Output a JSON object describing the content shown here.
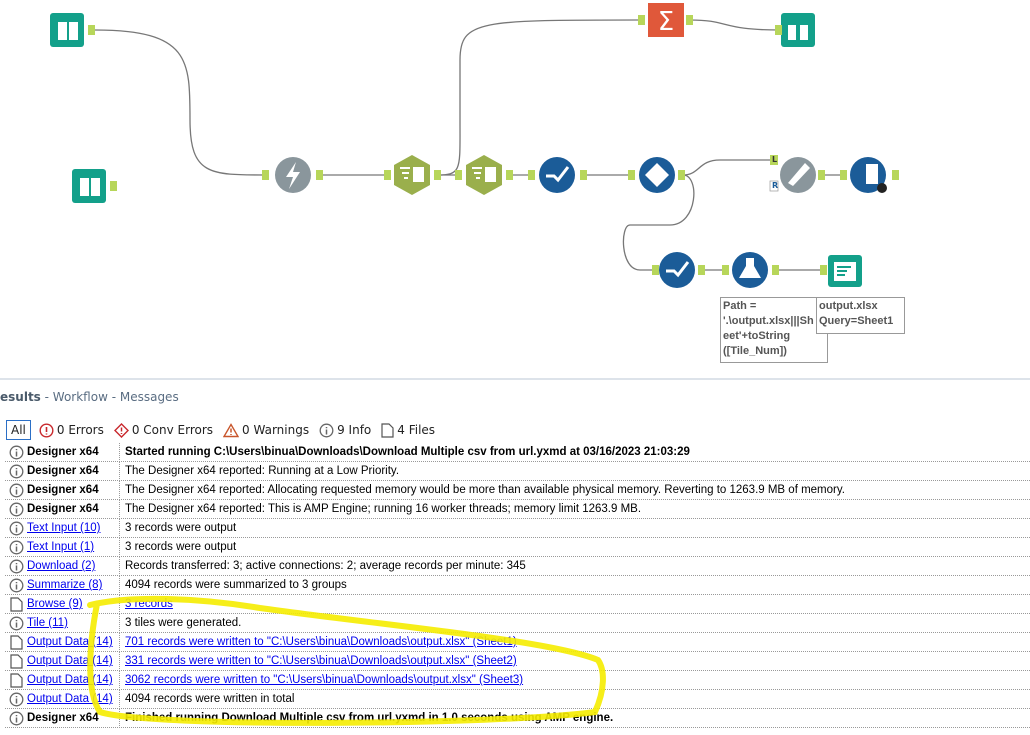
{
  "annotations": {
    "formula": [
      "Path =",
      "'.\\output.xlsx|||Sh",
      "eet'+toString",
      "([Tile_Num])"
    ],
    "output": [
      "output.xlsx",
      "Query=Sheet1"
    ]
  },
  "join_labels": {
    "left": "L",
    "right": "R"
  },
  "panel": {
    "title": "esults",
    "crumbs": " - Workflow - Messages"
  },
  "filters": [
    {
      "label": "All",
      "icon": "none"
    },
    {
      "label": "0 Errors",
      "icon": "error-icon"
    },
    {
      "label": "0 Conv Errors",
      "icon": "conv-error-icon"
    },
    {
      "label": "0 Warnings",
      "icon": "warning-icon"
    },
    {
      "label": "9 Info",
      "icon": "info-icon"
    },
    {
      "label": "4 Files",
      "icon": "file-icon"
    }
  ],
  "messages": [
    {
      "icon": "info",
      "tool": "Designer x64",
      "link": false,
      "msg": "Started running C:\\Users\\binua\\Downloads\\Download Multiple csv from url.yxmd at 03/16/2023 21:03:29",
      "bold": true,
      "msglink": false
    },
    {
      "icon": "info",
      "tool": "Designer x64",
      "link": false,
      "msg": "The Designer x64 reported: Running at a Low Priority.",
      "bold": false,
      "msglink": false
    },
    {
      "icon": "info",
      "tool": "Designer x64",
      "link": false,
      "msg": "The Designer x64 reported: Allocating requested memory would be more than available physical memory. Reverting to 1263.9 MB of memory.",
      "bold": false,
      "msglink": false
    },
    {
      "icon": "info",
      "tool": "Designer x64",
      "link": false,
      "msg": "The Designer x64 reported: This is AMP Engine; running 16 worker threads; memory limit 1263.9 MB.",
      "bold": false,
      "msglink": false
    },
    {
      "icon": "info",
      "tool": "Text Input (10)",
      "link": true,
      "msg": "3 records were output",
      "bold": false,
      "msglink": false
    },
    {
      "icon": "info",
      "tool": "Text Input (1)",
      "link": true,
      "msg": "3 records were output",
      "bold": false,
      "msglink": false
    },
    {
      "icon": "info",
      "tool": "Download (2)",
      "link": true,
      "msg": "Records transferred: 3; active connections: 2; average records per minute: 345",
      "bold": false,
      "msglink": false
    },
    {
      "icon": "info",
      "tool": "Summarize (8)",
      "link": true,
      "msg": "4094 records were summarized to 3 groups",
      "bold": false,
      "msglink": false
    },
    {
      "icon": "file",
      "tool": "Browse (9)",
      "link": true,
      "msg": "3 records",
      "bold": false,
      "msglink": true
    },
    {
      "icon": "info",
      "tool": "Tile (11)",
      "link": true,
      "msg": "3 tiles were generated.",
      "bold": false,
      "msglink": false
    },
    {
      "icon": "file",
      "tool": "Output Data (14)",
      "link": true,
      "msg": "701 records were written to \"C:\\Users\\binua\\Downloads\\output.xlsx\" (Sheet1)",
      "bold": false,
      "msglink": true
    },
    {
      "icon": "file",
      "tool": "Output Data (14)",
      "link": true,
      "msg": "331 records were written to \"C:\\Users\\binua\\Downloads\\output.xlsx\" (Sheet2)",
      "bold": false,
      "msglink": true
    },
    {
      "icon": "file",
      "tool": "Output Data (14)",
      "link": true,
      "msg": "3062 records were written to \"C:\\Users\\binua\\Downloads\\output.xlsx\" (Sheet3)",
      "bold": false,
      "msglink": true
    },
    {
      "icon": "info",
      "tool": "Output Data (14)",
      "link": true,
      "msg": "4094 records were written in total",
      "bold": false,
      "msglink": false
    },
    {
      "icon": "info",
      "tool": "Designer x64",
      "link": false,
      "msg": "Finished running Download Multiple csv from url.yxmd in 1.0 seconds using AMP engine.",
      "bold": true,
      "msglink": false
    }
  ],
  "colors": {
    "teal": "#13a08a",
    "olive": "#9aaf4c",
    "blue": "#1b5c98",
    "gray": "#8a969c",
    "orange": "#e0583a",
    "anchor": "#b7d65a",
    "highlight": "#f5ec00"
  }
}
